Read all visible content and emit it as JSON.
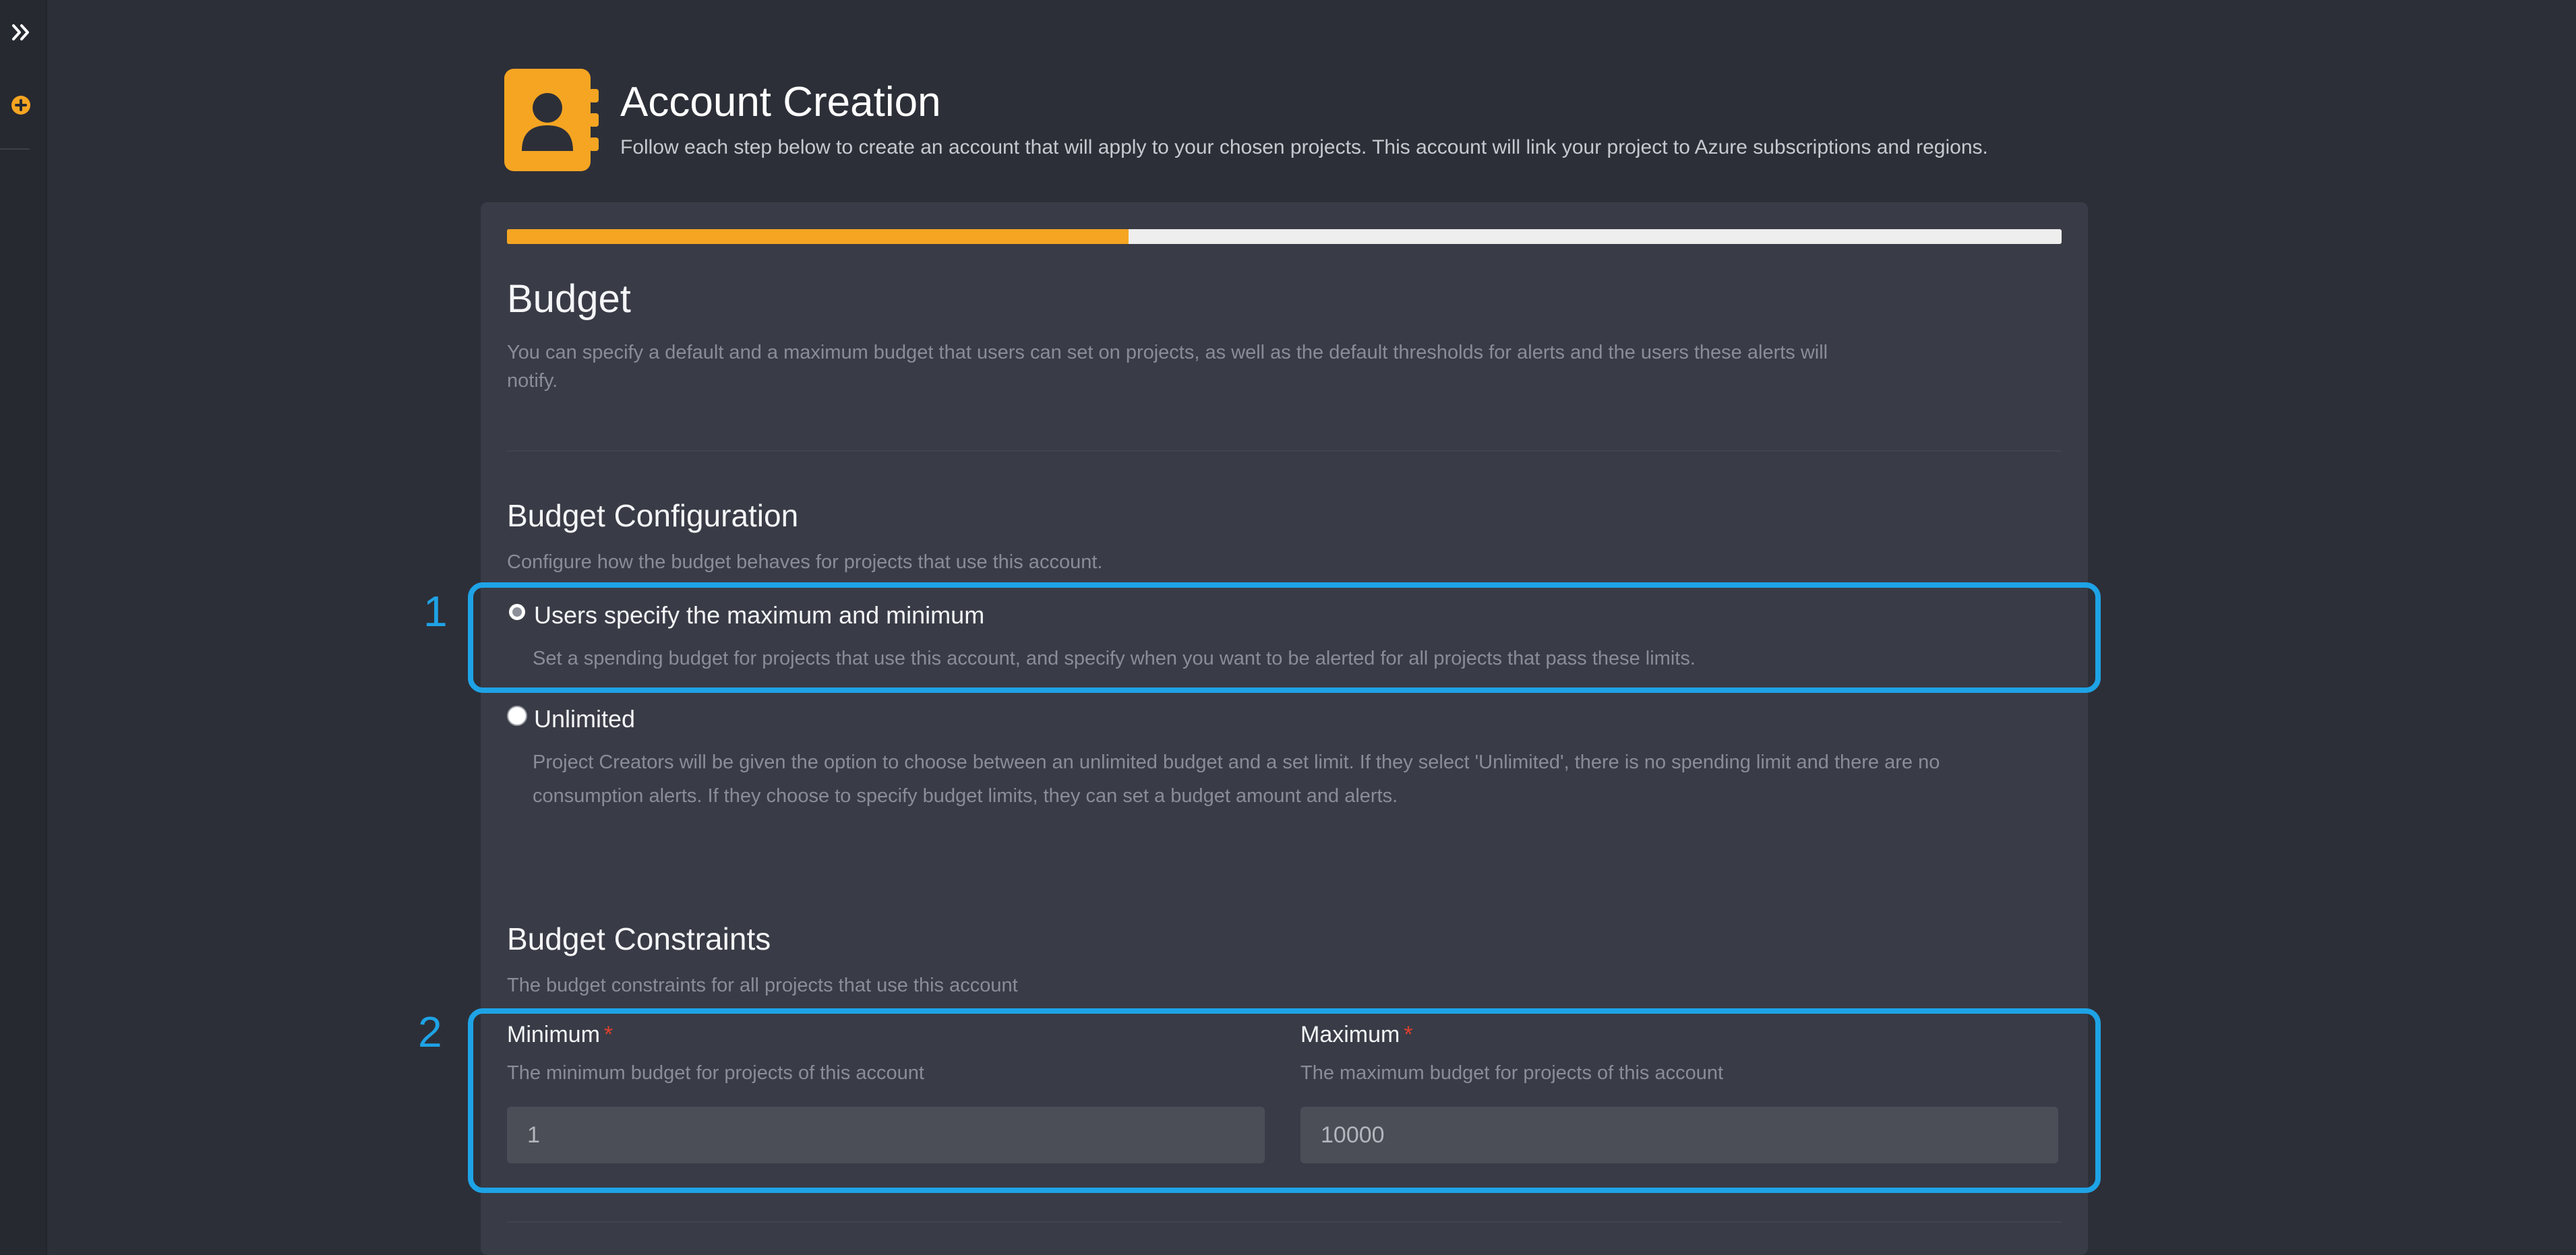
{
  "sidebar": {
    "expand_icon": "double-chevron-right-icon",
    "add_icon": "plus-circle-icon",
    "accent": "#f5a522"
  },
  "header": {
    "icon": "address-book-icon",
    "title": "Account Creation",
    "subtitle": "Follow each step below to create an account that will apply to your chosen projects. This account will link your project to Azure subscriptions and regions."
  },
  "progress": {
    "fraction": 0.4
  },
  "budget": {
    "title": "Budget",
    "description": "You can specify a default and a maximum budget that users can set on projects, as well as the default thresholds for alerts and the users these alerts will notify."
  },
  "configuration": {
    "title": "Budget Configuration",
    "description": "Configure how the budget behaves for projects that use this account.",
    "options": [
      {
        "label": "Users specify the maximum and minimum",
        "description": "Set a spending budget for projects that use this account, and specify when you want to be alerted for all projects that pass these limits.",
        "selected": true
      },
      {
        "label": "Unlimited",
        "description": "Project Creators will be given the option to choose between an unlimited budget and a set limit. If they select 'Unlimited', there is no spending limit and there are no consumption alerts. If they choose to specify budget limits, they can set a budget amount and alerts.",
        "selected": false
      }
    ]
  },
  "constraints": {
    "title": "Budget Constraints",
    "description": "The budget constraints for all projects that use this account",
    "minimum": {
      "label": "Minimum",
      "required_mark": "*",
      "help": "The minimum budget for projects of this account",
      "value": "1"
    },
    "maximum": {
      "label": "Maximum",
      "required_mark": "*",
      "help": "The maximum budget for projects of this account",
      "value": "10000"
    }
  },
  "annotations": {
    "first": "1",
    "second": "2",
    "color": "#1ea3e6"
  }
}
